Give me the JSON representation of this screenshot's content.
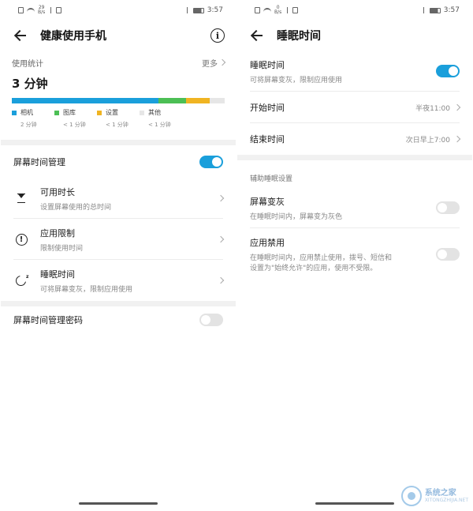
{
  "left": {
    "status": {
      "speed_top": "29",
      "speed_bottom": "B/s",
      "time": "3:57"
    },
    "header": {
      "title": "健康使用手机"
    },
    "usage": {
      "label": "使用统计",
      "more": "更多",
      "total": "3 分钟",
      "segments": [
        {
          "name": "相机",
          "value": "2 分钟",
          "fraction": 0.69,
          "color": "#1a9fdb"
        },
        {
          "name": "图库",
          "value": "< 1 分钟",
          "fraction": 0.13,
          "color": "#4cbf55"
        },
        {
          "name": "设置",
          "value": "< 1 分钟",
          "fraction": 0.11,
          "color": "#f0b422"
        },
        {
          "name": "其他",
          "value": "< 1 分钟",
          "fraction": 0.07,
          "color": "#e6e6e6"
        }
      ]
    },
    "screen_time_management": {
      "label": "屏幕时间管理",
      "on": true
    },
    "items": [
      {
        "label": "可用时长",
        "sub": "设置屏幕使用的总时间"
      },
      {
        "label": "应用限制",
        "sub": "限制使用时间"
      },
      {
        "label": "睡眠时间",
        "sub": "可将屏幕变灰，限制应用使用"
      }
    ],
    "password": {
      "label": "屏幕时间管理密码",
      "on": false
    }
  },
  "right": {
    "status": {
      "speed_top": "0",
      "speed_bottom": "B/s",
      "time": "3:57"
    },
    "header": {
      "title": "睡眠时间"
    },
    "sleep_toggle": {
      "label": "睡眠时间",
      "sub": "可将屏幕变灰，限制应用使用",
      "on": true
    },
    "start": {
      "label": "开始时间",
      "value": "半夜11:00"
    },
    "end": {
      "label": "结束时间",
      "value": "次日早上7:00"
    },
    "assist_title": "辅助睡眠设置",
    "grayscale": {
      "label": "屏幕变灰",
      "sub": "在睡眠时间内，屏幕变为灰色",
      "on": false
    },
    "app_block": {
      "label": "应用禁用",
      "sub_line1": "在睡眠时间内，应用禁止使用，拨号、短信和",
      "sub_line2": "设置为\"始终允许\"的应用，使用不受限。",
      "on": false
    }
  },
  "watermark": {
    "text_top": "系统之家",
    "text_bottom": "XITONGZHIJIA.NET"
  }
}
